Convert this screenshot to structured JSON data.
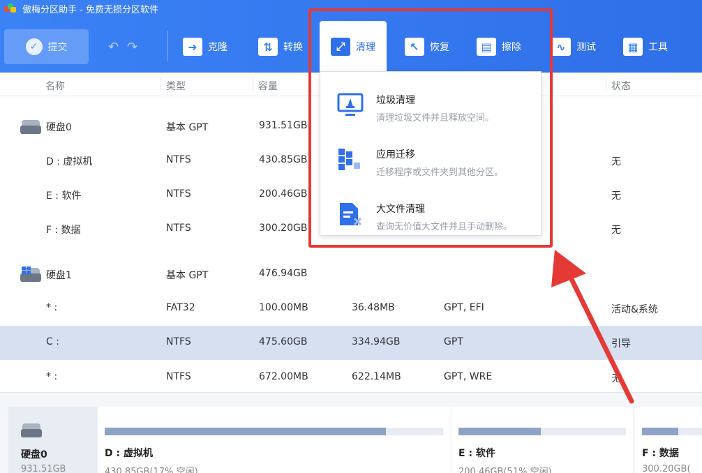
{
  "window": {
    "title": "傲梅分区助手 - 免费无损分区软件"
  },
  "toolbar": {
    "submit": "提交",
    "clone": "克隆",
    "convert": "转换",
    "clean": "清理",
    "restore": "恢复",
    "wipe": "擦除",
    "test": "测试",
    "tools": "工具"
  },
  "columns": {
    "name": "名称",
    "type": "类型",
    "capacity": "容量",
    "status": "状态"
  },
  "rows": [
    {
      "name": "硬盘0",
      "type": "基本 GPT",
      "capacity": "931.51GB",
      "used": "",
      "fs": "",
      "status": ""
    },
    {
      "name": "D : 虚拟机",
      "type": "NTFS",
      "capacity": "430.85GB",
      "used": "",
      "fs": "",
      "status": "无"
    },
    {
      "name": "E : 软件",
      "type": "NTFS",
      "capacity": "200.46GB",
      "used": "",
      "fs": "",
      "status": "无"
    },
    {
      "name": "F : 数据",
      "type": "NTFS",
      "capacity": "300.20GB",
      "used": "",
      "fs": "",
      "status": "无"
    },
    {
      "name": "硬盘1",
      "type": "基本 GPT",
      "capacity": "476.94GB",
      "used": "",
      "fs": "",
      "status": ""
    },
    {
      "name": "* :",
      "type": "FAT32",
      "capacity": "100.00MB",
      "used": "36.48MB",
      "fs": "GPT, EFI",
      "status": "活动&系统"
    },
    {
      "name": "C :",
      "type": "NTFS",
      "capacity": "475.60GB",
      "used": "334.94GB",
      "fs": "GPT",
      "status": "引导"
    },
    {
      "name": "* :",
      "type": "NTFS",
      "capacity": "672.00MB",
      "used": "622.14MB",
      "fs": "GPT, WRE",
      "status": "无"
    }
  ],
  "menu": [
    {
      "title": "垃圾清理",
      "desc": "清理垃圾文件并且释放空间。",
      "icon": "trash-clean-icon"
    },
    {
      "title": "应用迁移",
      "desc": "迁移程序或文件夹到其他分区。",
      "icon": "app-move-icon"
    },
    {
      "title": "大文件清理",
      "desc": "查询无价值大文件并且手动删除。",
      "icon": "large-file-icon"
    }
  ],
  "bottom": {
    "disk": {
      "name": "硬盘0",
      "size": "931.51GB"
    },
    "partitions": [
      {
        "name": "D : 虚拟机",
        "info": "430.85GB(17% 空闲)",
        "used_fraction": 0.83
      },
      {
        "name": "E : 软件",
        "info": "200.46GB(51% 空闲)",
        "used_fraction": 0.49
      },
      {
        "name": "F : 数据",
        "info": "300.20GB(",
        "used_fraction": 0.6
      }
    ]
  },
  "colors": {
    "accent": "#2f6fe8",
    "highlight": "#e53935",
    "selected_row": "#d6e0f1"
  }
}
